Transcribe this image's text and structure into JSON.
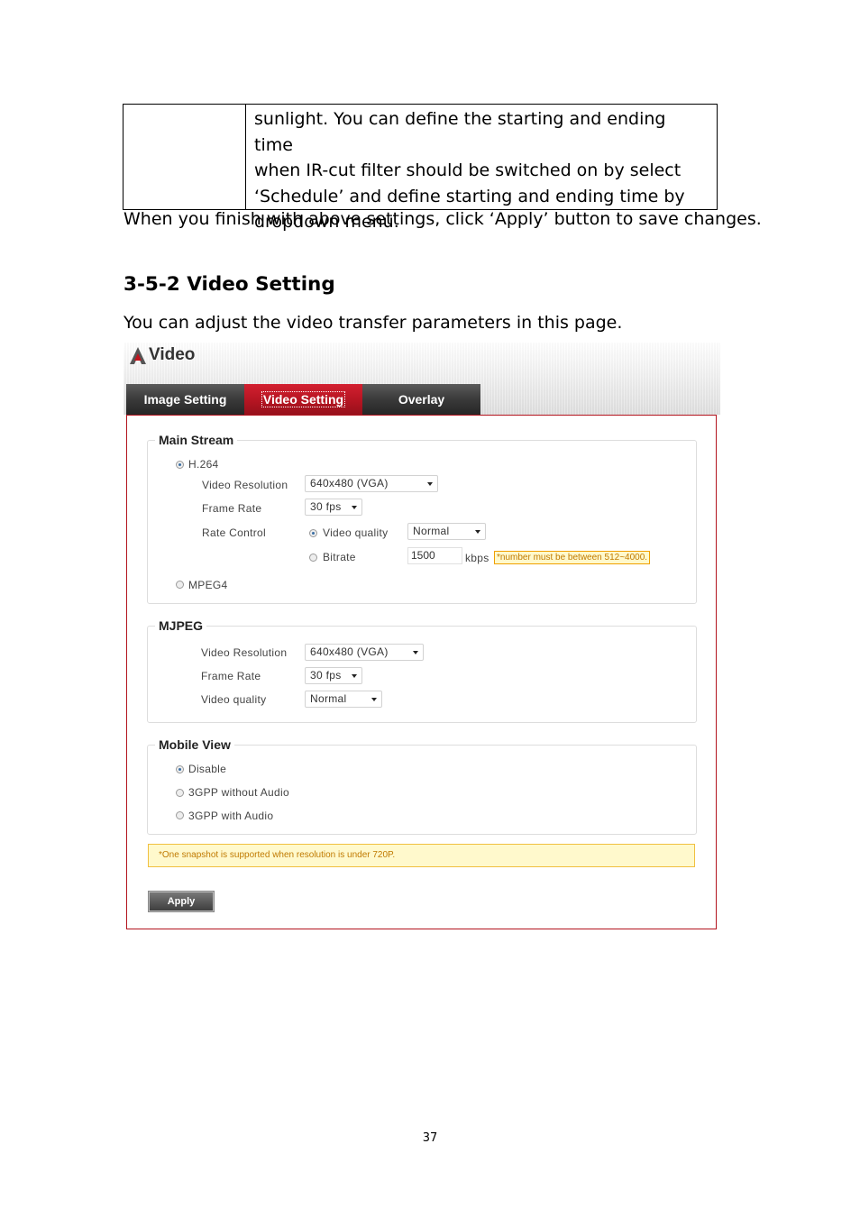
{
  "document": {
    "table_cell_lines": [
      "sunlight. You can define the starting and ending time",
      "when IR-cut filter should be switched on by select",
      "‘Schedule’ and define starting and ending time by",
      "dropdown menu."
    ],
    "finish_text": "When you finish with above settings, click ‘Apply’ button to save changes.",
    "section_heading": "3-5-2 Video Setting",
    "intro_text": "You can adjust the video transfer parameters in this page.",
    "page_number": "37"
  },
  "screenshot": {
    "header_title": "Video",
    "tabs": [
      {
        "label": "Image Setting",
        "active": false
      },
      {
        "label": "Video Setting",
        "active": true
      },
      {
        "label": "Overlay",
        "active": false
      }
    ],
    "main_stream": {
      "legend": "Main Stream",
      "h264_label": "H.264",
      "h264_selected": true,
      "video_resolution_label": "Video Resolution",
      "video_resolution_value": "640x480 (VGA)",
      "frame_rate_label": "Frame Rate",
      "frame_rate_value": "30 fps",
      "rate_control_label": "Rate Control",
      "video_quality_option_label": "Video quality",
      "video_quality_selected": true,
      "video_quality_value": "Normal",
      "bitrate_option_label": "Bitrate",
      "bitrate_value": "1500",
      "bitrate_unit": "kbps",
      "bitrate_hint": "*number must be between 512~4000.",
      "mpeg4_label": "MPEG4"
    },
    "mjpeg": {
      "legend": "MJPEG",
      "video_resolution_label": "Video Resolution",
      "video_resolution_value": "640x480 (VGA)",
      "frame_rate_label": "Frame Rate",
      "frame_rate_value": "30 fps",
      "video_quality_label": "Video quality",
      "video_quality_value": "Normal"
    },
    "mobile_view": {
      "legend": "Mobile View",
      "options": [
        "Disable",
        "3GPP without Audio",
        "3GPP with Audio"
      ],
      "selected": "Disable"
    },
    "note": "*One snapshot is supported when resolution is under 720P.",
    "apply_label": "Apply",
    "colors": {
      "accent_red": "#b51522",
      "tab_dark": "#3a3a3a",
      "hint_orange": "#c07a00"
    }
  }
}
